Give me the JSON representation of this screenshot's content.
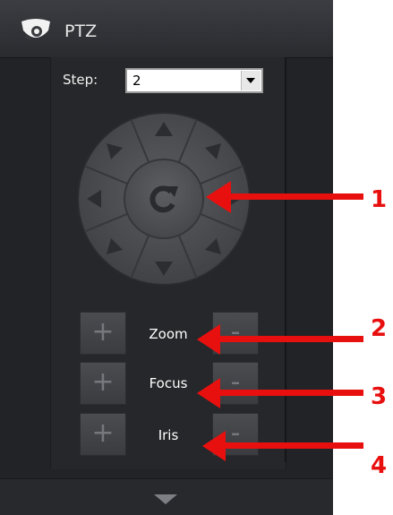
{
  "header": {
    "title": "PTZ",
    "icon": "camera-dome-icon"
  },
  "step": {
    "label": "Step:",
    "value": "2"
  },
  "joystick": {
    "center_icon": "refresh-icon",
    "directions": [
      "up",
      "up-right",
      "right",
      "down-right",
      "down",
      "down-left",
      "left",
      "up-left"
    ]
  },
  "controls": [
    {
      "plus": "+",
      "label": "Zoom",
      "minus": "-"
    },
    {
      "plus": "+",
      "label": "Focus",
      "minus": "-"
    },
    {
      "plus": "+",
      "label": "Iris",
      "minus": "-"
    }
  ],
  "footer": {
    "icon": "collapse-down-icon"
  },
  "annotations": [
    "1",
    "2",
    "3",
    "4"
  ],
  "colors": {
    "annotation": "#e8100f",
    "panel": "#222326",
    "button": "#42444a"
  }
}
